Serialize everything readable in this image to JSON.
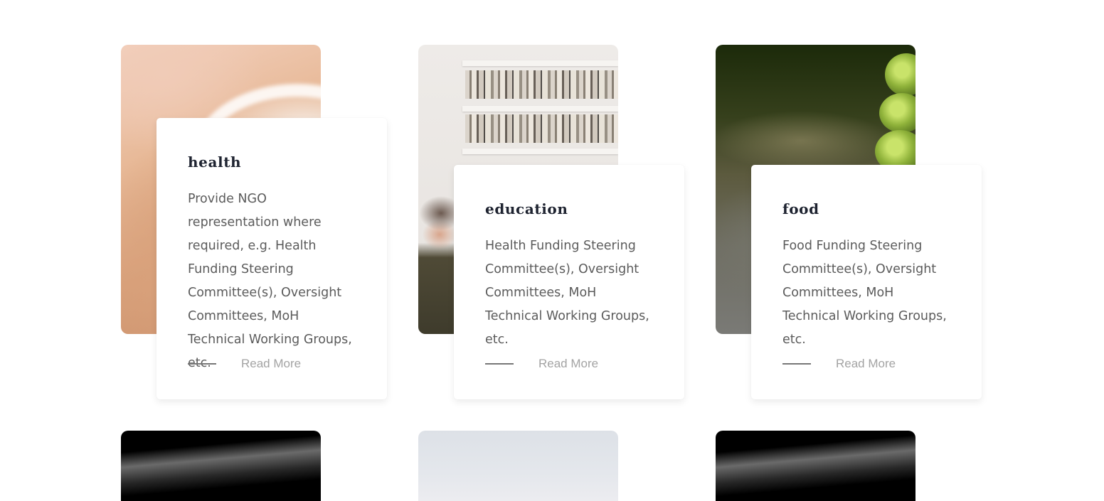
{
  "cards": [
    {
      "title": "health",
      "text": "Provide NGO representation where required, e.g. Health Funding Steering Committee(s), Oversight Committees, MoH Technical Working Groups, etc.",
      "link_label": "Read More"
    },
    {
      "title": "education",
      "text": "Health Funding Steering Committee(s), Oversight Committees, MoH Technical Working Groups, etc.",
      "link_label": "Read More"
    },
    {
      "title": "food",
      "text": "Food Funding Steering Committee(s), Oversight Committees, MoH Technical Working Groups, etc.",
      "link_label": "Read More"
    }
  ],
  "colors": {
    "title": "#1e2330",
    "body_text": "#5b5b5b",
    "link_text": "#a3a3a3",
    "link_line": "#777777",
    "card_bg": "#ffffff"
  }
}
